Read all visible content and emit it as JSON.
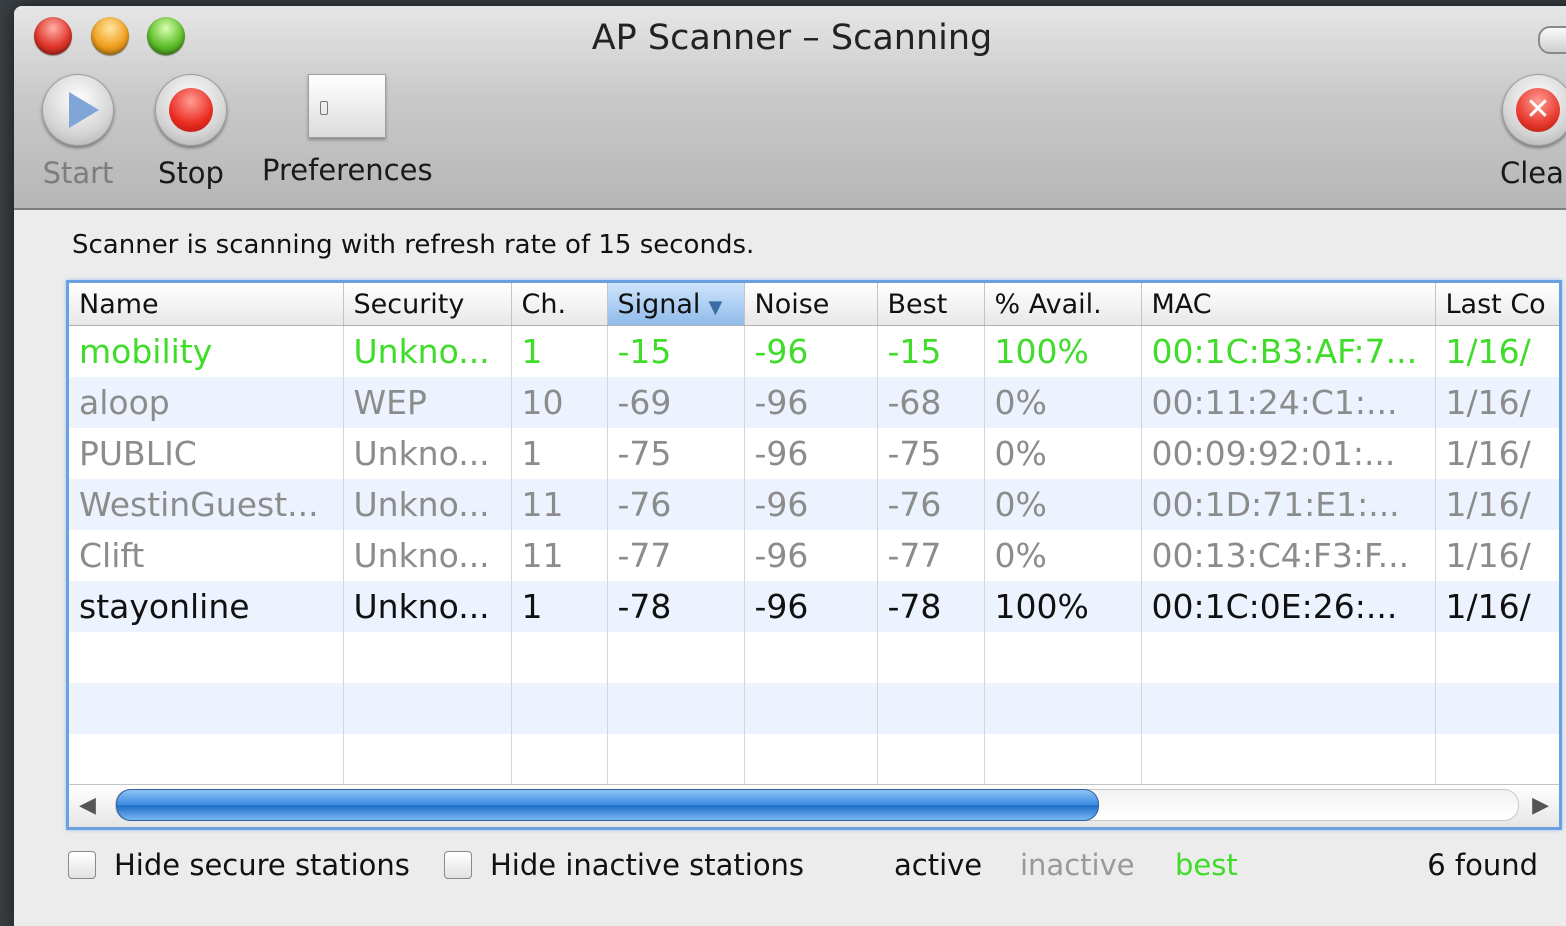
{
  "window": {
    "title": "AP Scanner – Scanning"
  },
  "toolbar": {
    "start_label": "Start",
    "stop_label": "Stop",
    "preferences_label": "Preferences",
    "clear_label": "Clear"
  },
  "status": {
    "text": "Scanner is scanning with refresh rate of 15 seconds."
  },
  "table": {
    "columns": [
      "Name",
      "Security",
      "Ch.",
      "Signal",
      "Noise",
      "Best",
      "% Avail.",
      "MAC",
      "Last Co"
    ],
    "sorted_column": "Signal",
    "rows": [
      {
        "state": "best",
        "cells": [
          "mobility",
          "Unkno...",
          "1",
          "-15",
          "-96",
          "-15",
          "100%",
          "00:1C:B3:AF:7...",
          "1/16/"
        ]
      },
      {
        "state": "inactive",
        "cells": [
          "aloop",
          "WEP",
          "10",
          "-69",
          "-96",
          "-68",
          "0%",
          "00:11:24:C1:...",
          "1/16/"
        ]
      },
      {
        "state": "inactive",
        "cells": [
          "PUBLIC",
          "Unkno...",
          "1",
          "-75",
          "-96",
          "-75",
          "0%",
          "00:09:92:01:...",
          "1/16/"
        ]
      },
      {
        "state": "inactive",
        "cells": [
          "WestinGuest...",
          "Unkno...",
          "11",
          "-76",
          "-96",
          "-76",
          "0%",
          "00:1D:71:E1:...",
          "1/16/"
        ]
      },
      {
        "state": "inactive",
        "cells": [
          "Clift",
          "Unkno...",
          "11",
          "-77",
          "-96",
          "-77",
          "0%",
          "00:13:C4:F3:F...",
          "1/16/"
        ]
      },
      {
        "state": "active",
        "cells": [
          "stayonline",
          "Unkno...",
          "1",
          "-78",
          "-96",
          "-78",
          "100%",
          "00:1C:0E:26:...",
          "1/16/"
        ]
      }
    ],
    "empty_rows": 3,
    "scroll_fraction": 0.7
  },
  "footer": {
    "hide_secure_label": "Hide secure stations",
    "hide_inactive_label": "Hide inactive stations",
    "legend_active": "active",
    "legend_inactive": "inactive",
    "legend_best": "best",
    "found_text": "6 found"
  },
  "colors": {
    "best": "#3fdc2a",
    "inactive": "#8c8c8c",
    "active": "#111111",
    "selection": "#6aa0e0"
  },
  "icons": {
    "start": "play-icon",
    "stop": "stop-icon",
    "preferences": "preferences-icon",
    "clear": "clear-icon"
  }
}
